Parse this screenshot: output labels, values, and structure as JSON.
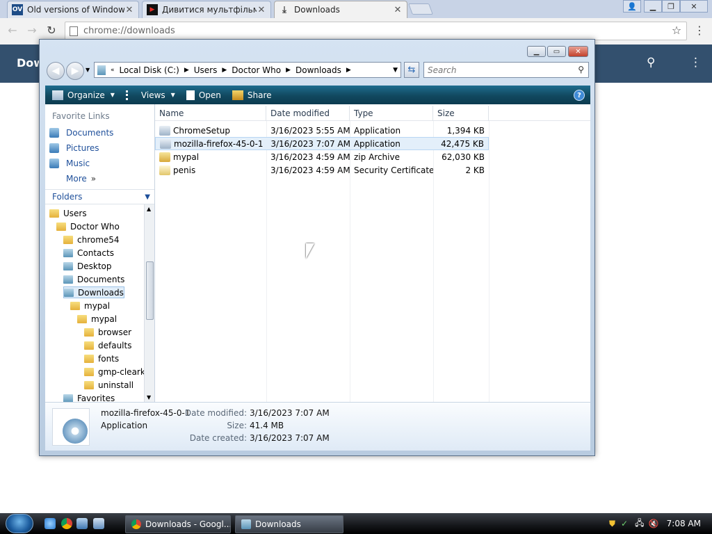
{
  "browser": {
    "tabs": [
      {
        "title": "Old versions of Windows",
        "favicon": "OV",
        "active": false
      },
      {
        "title": "Дивитися мультфільми",
        "favicon": "youtube",
        "active": false
      },
      {
        "title": "Downloads",
        "favicon": "download",
        "active": true
      }
    ],
    "address": "chrome://downloads",
    "page_header": "Dow"
  },
  "explorer": {
    "breadcrumb": [
      "Local Disk (C:)",
      "Users",
      "Doctor Who",
      "Downloads"
    ],
    "search_placeholder": "Search",
    "commands": {
      "organize": "Organize",
      "views": "Views",
      "open": "Open",
      "share": "Share"
    },
    "favorite_links_header": "Favorite Links",
    "favorite_links": [
      "Documents",
      "Pictures",
      "Music",
      "More"
    ],
    "folders_header": "Folders",
    "tree": [
      {
        "label": "Users",
        "depth": 0,
        "kind": "folder"
      },
      {
        "label": "Doctor Who",
        "depth": 1,
        "kind": "folder"
      },
      {
        "label": "chrome54",
        "depth": 2,
        "kind": "folder"
      },
      {
        "label": "Contacts",
        "depth": 2,
        "kind": "library"
      },
      {
        "label": "Desktop",
        "depth": 2,
        "kind": "library"
      },
      {
        "label": "Documents",
        "depth": 2,
        "kind": "library"
      },
      {
        "label": "Downloads",
        "depth": 2,
        "kind": "library",
        "selected": true
      },
      {
        "label": "mypal",
        "depth": 3,
        "kind": "zip"
      },
      {
        "label": "mypal",
        "depth": 4,
        "kind": "folder"
      },
      {
        "label": "browser",
        "depth": 5,
        "kind": "folder"
      },
      {
        "label": "defaults",
        "depth": 5,
        "kind": "folder"
      },
      {
        "label": "fonts",
        "depth": 5,
        "kind": "folder"
      },
      {
        "label": "gmp-clearke",
        "depth": 5,
        "kind": "folder"
      },
      {
        "label": "uninstall",
        "depth": 5,
        "kind": "folder"
      },
      {
        "label": "Favorites",
        "depth": 2,
        "kind": "favorites"
      }
    ],
    "columns": [
      "Name",
      "Date modified",
      "Type",
      "Size"
    ],
    "files": [
      {
        "name": "ChromeSetup",
        "date": "3/16/2023 5:55 AM",
        "type": "Application",
        "size": "1,394 KB",
        "icon": "app"
      },
      {
        "name": "mozilla-firefox-45-0-1",
        "date": "3/16/2023 7:07 AM",
        "type": "Application",
        "size": "42,475 KB",
        "icon": "app",
        "selected": true
      },
      {
        "name": "mypal",
        "date": "3/16/2023 4:59 AM",
        "type": "zip Archive",
        "size": "62,030 KB",
        "icon": "zip"
      },
      {
        "name": "penis",
        "date": "3/16/2023 4:59 AM",
        "type": "Security Certificate",
        "size": "2 KB",
        "icon": "cert"
      }
    ],
    "details": {
      "name": "mozilla-firefox-45-0-1",
      "type": "Application",
      "date_modified_label": "Date modified:",
      "date_modified": "3/16/2023 7:07 AM",
      "size_label": "Size:",
      "size": "41.4 MB",
      "date_created_label": "Date created:",
      "date_created": "3/16/2023 7:07 AM"
    }
  },
  "taskbar": {
    "buttons": [
      {
        "label": "Downloads - Googl...",
        "icon": "chrome"
      },
      {
        "label": "Downloads",
        "icon": "explorer-folder"
      }
    ],
    "clock": "7:08 AM"
  }
}
